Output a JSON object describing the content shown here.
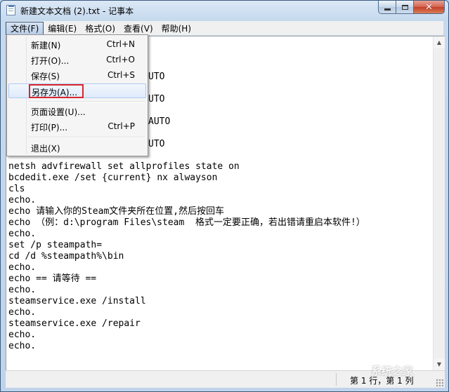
{
  "window": {
    "title": "新建文本文档 (2).txt - 记事本",
    "controls": {
      "minimize": "minimize-icon",
      "maximize": "maximize-icon",
      "close": "close-icon"
    }
  },
  "menubar": [
    {
      "label": "文件(F)",
      "open": true
    },
    {
      "label": "编辑(E)"
    },
    {
      "label": "格式(O)"
    },
    {
      "label": "查看(V)"
    },
    {
      "label": "帮助(H)"
    }
  ],
  "file_menu": [
    {
      "label": "新建(N)",
      "shortcut": "Ctrl+N"
    },
    {
      "label": "打开(O)...",
      "shortcut": "Ctrl+O"
    },
    {
      "label": "保存(S)",
      "shortcut": "Ctrl+S"
    },
    {
      "label": "另存为(A)...",
      "shortcut": "",
      "highlighted": true
    },
    {
      "label": "页面设置(U)...",
      "shortcut": ""
    },
    {
      "label": "打印(P)...",
      "shortcut": "Ctrl+P"
    },
    {
      "label": "退出(X)",
      "shortcut": ""
    }
  ],
  "editor": {
    "visible_fragments": [
      "UTO",
      "UTO",
      "AUTO",
      "UTO"
    ],
    "lines": [
      "netsh advfirewall set allprofiles state on",
      "bcdedit.exe /set {current} nx alwayson",
      "cls",
      "echo.",
      "echo 请输入你的Steam文件夹所在位置,然后按回车",
      "echo （例：d:\\program Files\\steam  格式一定要正确，若出错请重启本软件!）",
      "echo.",
      "set /p steampath=",
      "cd /d %steampath%\\bin",
      "echo.",
      "echo == 请等待 ==",
      "echo.",
      "steamservice.exe /install",
      "echo.",
      "steamservice.exe /repair",
      "echo.",
      "echo."
    ]
  },
  "statusbar": {
    "position": "第 1 行，第 1 列"
  },
  "watermark": "系统之家",
  "colors": {
    "highlight_box": "#d9262c",
    "accent": "#3c5778"
  }
}
